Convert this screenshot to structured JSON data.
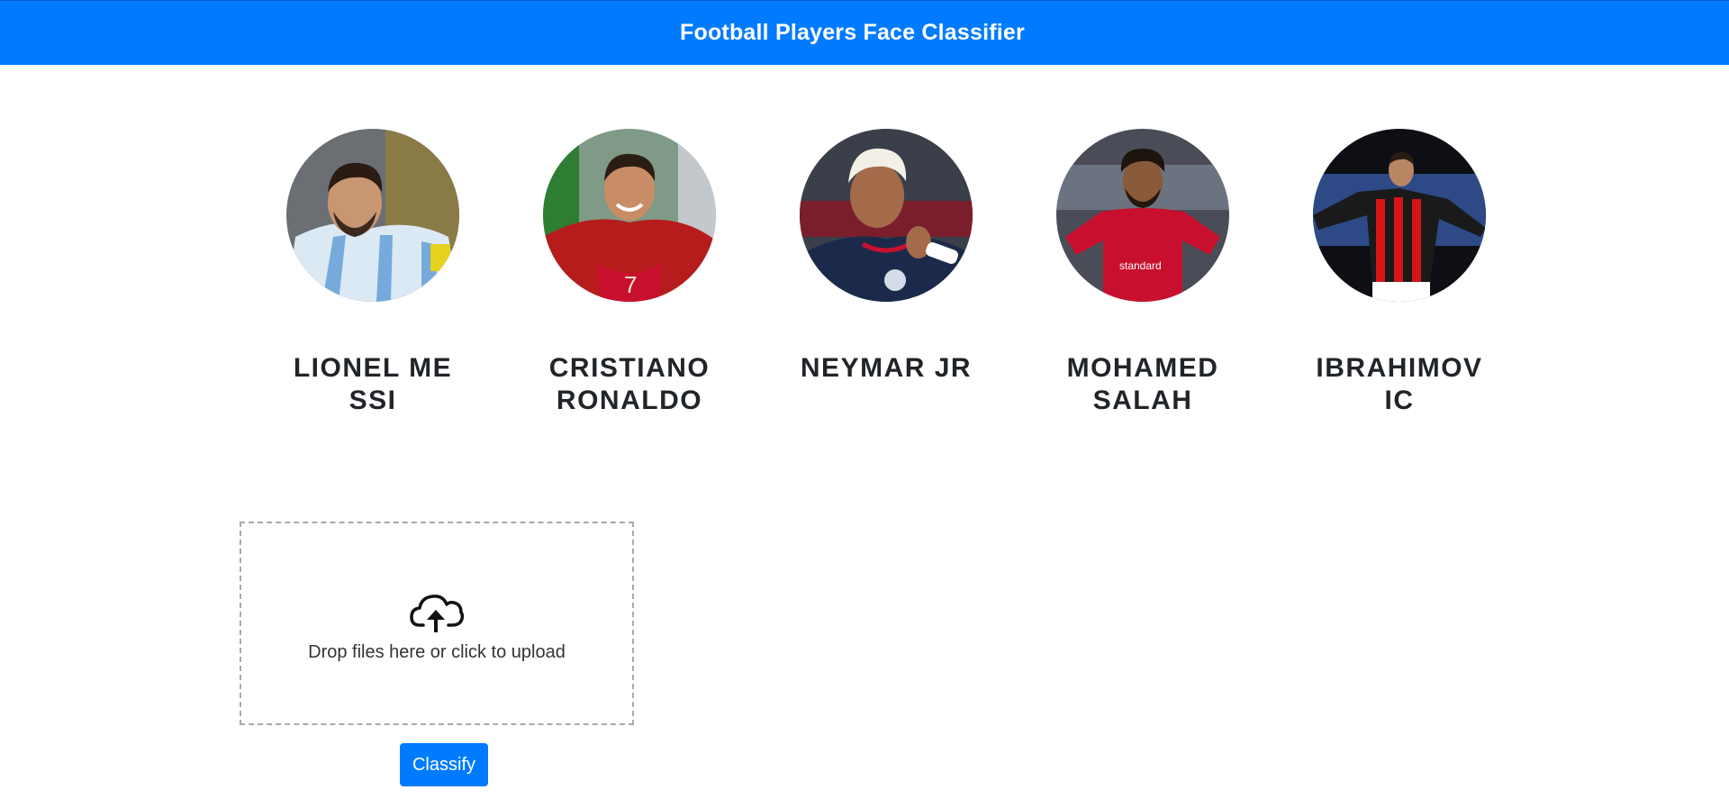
{
  "header": {
    "title": "Football Players Face Classifier",
    "background": "#007bff"
  },
  "players": [
    {
      "name": "LIONEL MESSI",
      "icon": "player-photo-messi",
      "jersey": "#75aadb"
    },
    {
      "name": "CRISTIANO RONALDO",
      "icon": "player-photo-ronaldo",
      "jersey": "#c8102e"
    },
    {
      "name": "NEYMAR JR",
      "icon": "player-photo-neymar",
      "jersey": "#1b2a4a"
    },
    {
      "name": "MOHAMED SALAH",
      "icon": "player-photo-salah",
      "jersey": "#c8102e"
    },
    {
      "name": "IBRAHIMOVIC",
      "icon": "player-photo-ibrahimovic",
      "jersey": "#d7141a"
    }
  ],
  "upload": {
    "icon": "cloud-upload-icon",
    "text": "Drop files here or click to upload"
  },
  "actions": {
    "classify_label": "Classify"
  }
}
